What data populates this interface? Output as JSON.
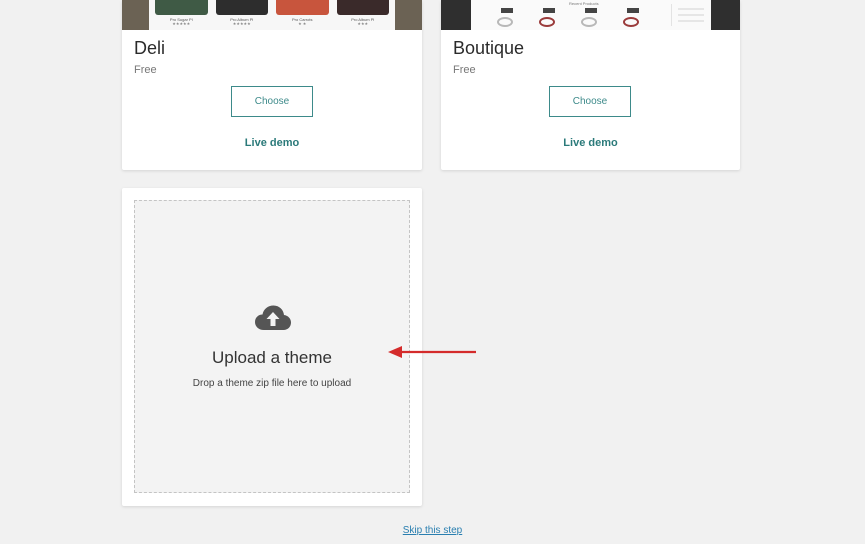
{
  "themes": [
    {
      "name": "Deli",
      "price": "Free",
      "choose_label": "Choose",
      "demo_label": "Live demo",
      "preview": {
        "products": [
          {
            "caption": "Pro Sugar Pl",
            "rating": "★★★★★",
            "color": "#3f5a45"
          },
          {
            "caption": "Pro Album Pl",
            "rating": "★★★★★",
            "color": "#2d2d2d"
          },
          {
            "caption": "Pro Carrots",
            "rating": "★ ★",
            "color": "#c8553d"
          },
          {
            "caption": "Pro Album Pl",
            "rating": "★★★",
            "color": "#3a2a2a"
          }
        ]
      }
    },
    {
      "name": "Boutique",
      "price": "Free",
      "choose_label": "Choose",
      "demo_label": "Live demo",
      "preview": {
        "heading": "Recent Products"
      }
    }
  ],
  "upload": {
    "icon": "cloud-upload-icon",
    "title": "Upload a theme",
    "subtitle": "Drop a theme zip file here to upload"
  },
  "annotation": {
    "icon": "red-arrow-icon",
    "color": "#d42b2b"
  },
  "footer": {
    "skip_label": "Skip this step"
  },
  "colors": {
    "accent": "#3d8a8a",
    "link": "#2a7fb0",
    "background": "#f1f1f1"
  }
}
